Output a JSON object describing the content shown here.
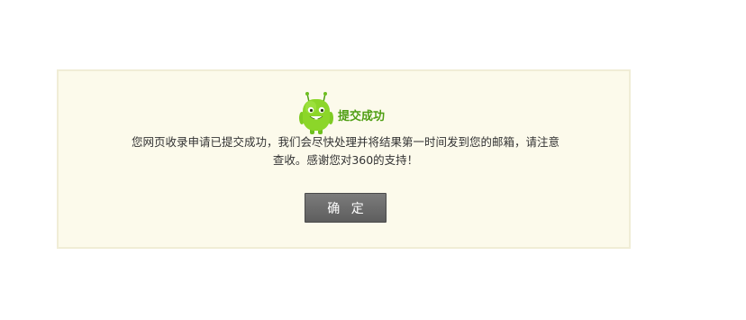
{
  "dialog": {
    "title": "提交成功",
    "message_line1": "您网页收录申请已提交成功，我们会尽快处理并将结果第一时间发到您的邮箱，请注意",
    "message_line2": "查收。感谢您对360的支持！",
    "confirm_label": "确 定",
    "mascot_icon": "green-robot-mascot-icon"
  },
  "colors": {
    "box_background": "#fcfaeb",
    "box_border": "#f0edd6",
    "title": "#4e9e12",
    "mascot": "#8cd629",
    "button": "#6b6b6b"
  }
}
